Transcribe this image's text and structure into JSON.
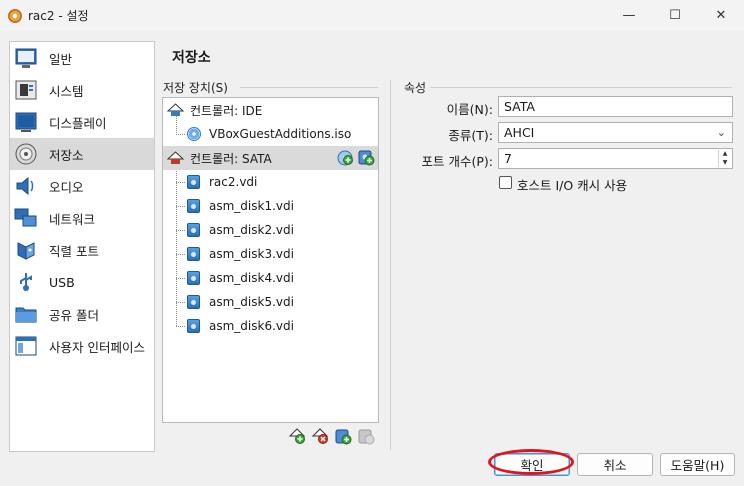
{
  "window": {
    "title": "rac2 - 설정",
    "min_glyph": "—",
    "max_glyph": "☐",
    "close_glyph": "✕"
  },
  "sidebar": {
    "items": [
      {
        "label": "일반",
        "icon": "general-icon",
        "selected": false
      },
      {
        "label": "시스템",
        "icon": "system-icon",
        "selected": false
      },
      {
        "label": "디스플레이",
        "icon": "display-icon",
        "selected": false
      },
      {
        "label": "저장소",
        "icon": "storage-icon",
        "selected": true
      },
      {
        "label": "오디오",
        "icon": "audio-icon",
        "selected": false
      },
      {
        "label": "네트워크",
        "icon": "network-icon",
        "selected": false
      },
      {
        "label": "직렬 포트",
        "icon": "serial-port-icon",
        "selected": false
      },
      {
        "label": "USB",
        "icon": "usb-icon",
        "selected": false
      },
      {
        "label": "공유 폴더",
        "icon": "shared-folder-icon",
        "selected": false
      },
      {
        "label": "사용자 인터페이스",
        "icon": "user-interface-icon",
        "selected": false
      }
    ]
  },
  "page": {
    "title": "저장소"
  },
  "storage": {
    "section_label": "저장 장치(S)",
    "controllers": [
      {
        "label": "컨트롤러: IDE",
        "selected": false,
        "attachments": [
          {
            "label": "VBoxGuestAdditions.iso",
            "type": "optical"
          }
        ]
      },
      {
        "label": "컨트롤러: SATA",
        "selected": true,
        "attachments": [
          {
            "label": "rac2.vdi",
            "type": "hdd"
          },
          {
            "label": "asm_disk1.vdi",
            "type": "hdd"
          },
          {
            "label": "asm_disk2.vdi",
            "type": "hdd"
          },
          {
            "label": "asm_disk3.vdi",
            "type": "hdd"
          },
          {
            "label": "asm_disk4.vdi",
            "type": "hdd"
          },
          {
            "label": "asm_disk5.vdi",
            "type": "hdd"
          },
          {
            "label": "asm_disk6.vdi",
            "type": "hdd"
          }
        ]
      }
    ]
  },
  "attributes": {
    "section_label": "속성",
    "name_label": "이름(N):",
    "name_value": "SATA",
    "type_label": "종류(T):",
    "type_value": "AHCI",
    "port_label": "포트 개수(P):",
    "port_value": "7",
    "cache_label": "호스트 I/O 캐시 사용",
    "cache_checked": false
  },
  "buttons": {
    "ok": "확인",
    "cancel": "취소",
    "help": "도움말(H)"
  },
  "colors": {
    "annotation": "#e0141c",
    "accent": "#4a8fd4",
    "add_green": "#3aa53a",
    "remove_red": "#d23a2a"
  }
}
